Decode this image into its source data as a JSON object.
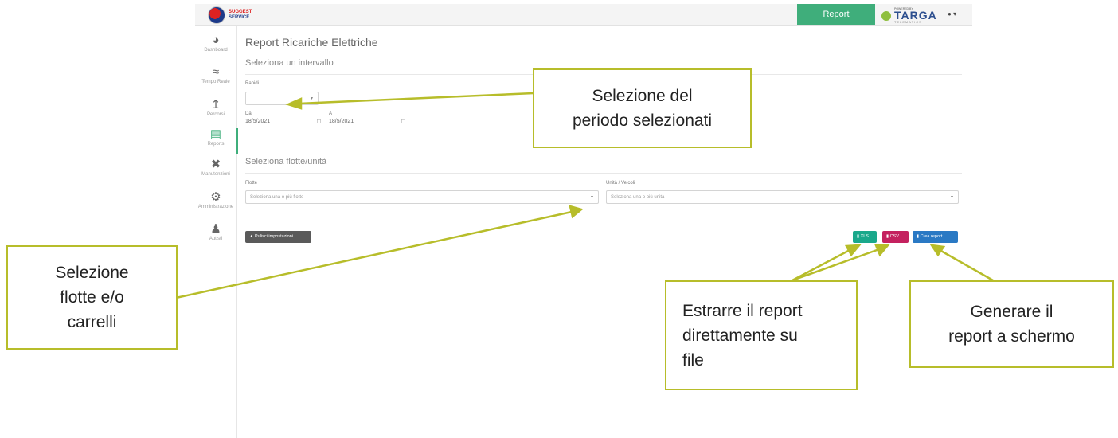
{
  "brand": {
    "line1": "SUGGEST",
    "line2": "SERVICE"
  },
  "header": {
    "report_tab": "Report",
    "targa_powered": "POWERED BY",
    "targa_name": "TARGA",
    "targa_sub": "TELEMATICS",
    "user_icon": "user-icon",
    "user_caret": "▾"
  },
  "sidebar": {
    "items": [
      {
        "label": "Dashboard",
        "icon": "speedometer-icon"
      },
      {
        "label": "Tempo Reale",
        "icon": "wifi-icon"
      },
      {
        "label": "Percorsi",
        "icon": "route-icon"
      },
      {
        "label": "Reports",
        "icon": "report-icon"
      },
      {
        "label": "Manutenzioni",
        "icon": "tools-icon"
      },
      {
        "label": "Amministrazione",
        "icon": "gears-icon"
      },
      {
        "label": "Autisti",
        "icon": "drivers-icon"
      }
    ],
    "active_index": 3
  },
  "main": {
    "title": "Report Ricariche Elettriche",
    "interval_title": "Seleziona un intervallo",
    "quick_label": "Rapidi",
    "quick_value": "",
    "from_label": "Da",
    "from_value": "18/5/2021",
    "to_label": "A",
    "to_value": "18/5/2021",
    "fleet_section_title": "Seleziona flotte/unità",
    "fleet_label": "Flotte",
    "fleet_placeholder": "Seleziona una o più flotte",
    "units_label": "Unità / Veicoli",
    "units_placeholder": "Seleziona una o più unità",
    "clear_button": "Pulisci impostazioni",
    "xls_button": "XLS",
    "csv_button": "CSV",
    "create_button": "Crea report"
  },
  "callouts": {
    "period": [
      "Selezione del",
      "periodo selezionati"
    ],
    "fleets": [
      "Selezione",
      "flotte e/o",
      "carrelli"
    ],
    "export": [
      "Estrarre il report",
      "direttamente su",
      "file"
    ],
    "generate": [
      "Generare il",
      "report a schermo"
    ]
  },
  "colors": {
    "accent_green": "#3fae7b",
    "callout_border": "#b7bd2a",
    "xls": "#1aa88b",
    "csv": "#c4215f",
    "create": "#2a79c4"
  }
}
